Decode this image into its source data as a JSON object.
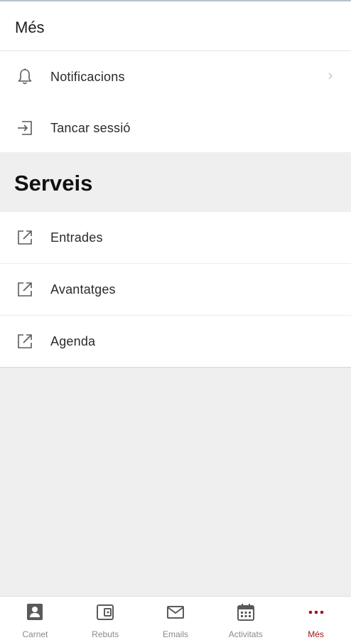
{
  "header": {
    "title": "Més"
  },
  "account": {
    "items": [
      {
        "label": "Notificacions",
        "icon": "bell-icon"
      },
      {
        "label": "Tancar sessió",
        "icon": "logout-icon"
      }
    ]
  },
  "services": {
    "title": "Serveis",
    "items": [
      {
        "label": "Entrades",
        "icon": "external-link-icon"
      },
      {
        "label": "Avantatges",
        "icon": "external-link-icon"
      },
      {
        "label": "Agenda",
        "icon": "external-link-icon"
      }
    ]
  },
  "tabbar": {
    "tabs": [
      {
        "label": "Carnet",
        "icon": "id-card-icon"
      },
      {
        "label": "Rebuts",
        "icon": "wallet-icon"
      },
      {
        "label": "Emails",
        "icon": "mail-icon"
      },
      {
        "label": "Activitats",
        "icon": "calendar-icon"
      },
      {
        "label": "Més",
        "icon": "more-dots-icon"
      }
    ],
    "active_index": 4
  },
  "colors": {
    "accent": "#a0161c",
    "icon_gray": "#5a5a5a",
    "background": "#efefef"
  }
}
